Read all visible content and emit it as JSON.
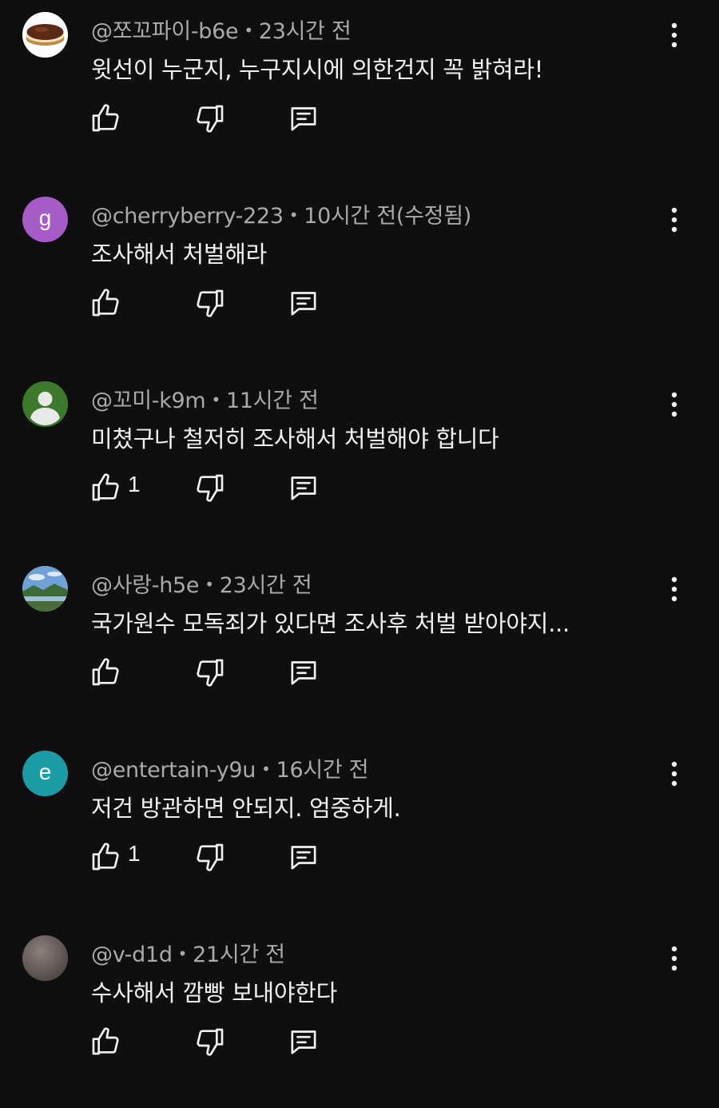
{
  "comments": [
    {
      "handle": "@쪼꼬파이-b6e",
      "time": "23시간 전",
      "text": "윗선이 누군지, 누구지시에 의한건지 꼭 밝혀라!",
      "avatar_type": "image",
      "avatar_letter": "",
      "avatar_color": "#ffffff",
      "like_count": ""
    },
    {
      "handle": "@cherryberry-223",
      "time": "10시간 전(수정됨)",
      "text": "조사해서 처벌해라",
      "avatar_type": "letter",
      "avatar_letter": "g",
      "avatar_color": "#a65bc9",
      "like_count": ""
    },
    {
      "handle": "@꼬미-k9m",
      "time": "11시간 전",
      "text": "미쳤구나 철저히 조사해서 처벌해야 합니다",
      "avatar_type": "person",
      "avatar_letter": "",
      "avatar_color": "#3a7a2a",
      "like_count": "1"
    },
    {
      "handle": "@사랑-h5e",
      "time": "23시간 전",
      "text": "국가원수 모독죄가 있다면 조사후 처벌 받아야지...",
      "avatar_type": "image",
      "avatar_letter": "",
      "avatar_color": "#5b8fc4",
      "like_count": ""
    },
    {
      "handle": "@entertain-y9u",
      "time": "16시간 전",
      "text": "저건 방관하면 안되지. 엄중하게.",
      "avatar_type": "letter",
      "avatar_letter": "e",
      "avatar_color": "#1a9ca6",
      "like_count": "1"
    },
    {
      "handle": "@v-d1d",
      "time": "21시간 전",
      "text": "수사해서 깜빵 보내야한다",
      "avatar_type": "image",
      "avatar_letter": "",
      "avatar_color": "#6e6462",
      "like_count": ""
    }
  ],
  "separator": "•",
  "icons": {
    "like": "thumb-up-icon",
    "dislike": "thumb-down-icon",
    "reply": "reply-icon",
    "more": "more-vert-icon"
  }
}
